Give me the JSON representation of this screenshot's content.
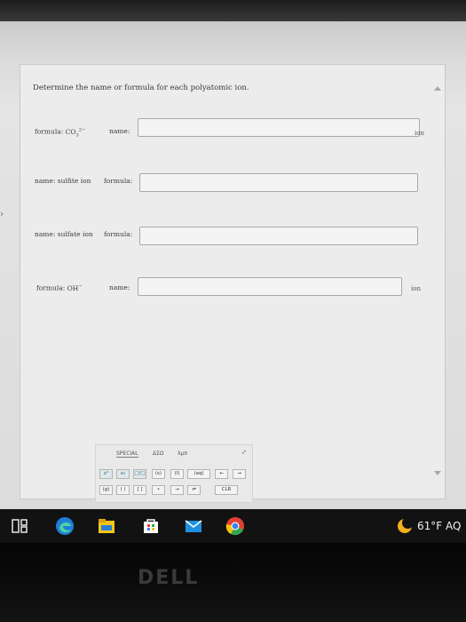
{
  "question": {
    "instruction": "Determine the name or formula for each polyatomic ion.",
    "rows": [
      {
        "given_label": "formula:",
        "given_value": "CO",
        "given_sub": "3",
        "given_sup": "2−",
        "ask_label": "name:",
        "answer": "",
        "suffix": "ion"
      },
      {
        "given_label": "name:",
        "given_value": "sulfite ion",
        "ask_label": "formula:",
        "answer": "",
        "suffix": ""
      },
      {
        "given_label": "name:",
        "given_value": "sulfate ion",
        "ask_label": "formula:",
        "answer": "",
        "suffix": ""
      },
      {
        "given_label": "formula:",
        "given_value": "OH",
        "given_sup": "−",
        "ask_label": "name:",
        "answer": "",
        "suffix": "ion"
      }
    ]
  },
  "toolbar": {
    "tabs": [
      "SPECIAL",
      "ΔΣΩ",
      "λμπ"
    ],
    "row1": [
      "x⁰",
      "x₀",
      "□/□",
      "(s)",
      "(l)",
      "(aq)",
      "←",
      "→"
    ],
    "row2": [
      "(g)",
      "( )",
      "[ ]",
      "•",
      "→",
      "⇌",
      "CLR"
    ],
    "expand_glyph": "⤢"
  },
  "taskbar": {
    "weather": "61°F AQ"
  },
  "bezel": {
    "brand": "DELL"
  },
  "colors": {
    "taskbar": "#121212",
    "edge": "#1e7fd8",
    "files": "#f5c518",
    "store": "#ffffff",
    "mail": "#1f8fe0",
    "chrome_red": "#e34133",
    "chrome_yellow": "#f4c20d",
    "chrome_green": "#2fa84f",
    "chrome_blue": "#3b82f0"
  }
}
